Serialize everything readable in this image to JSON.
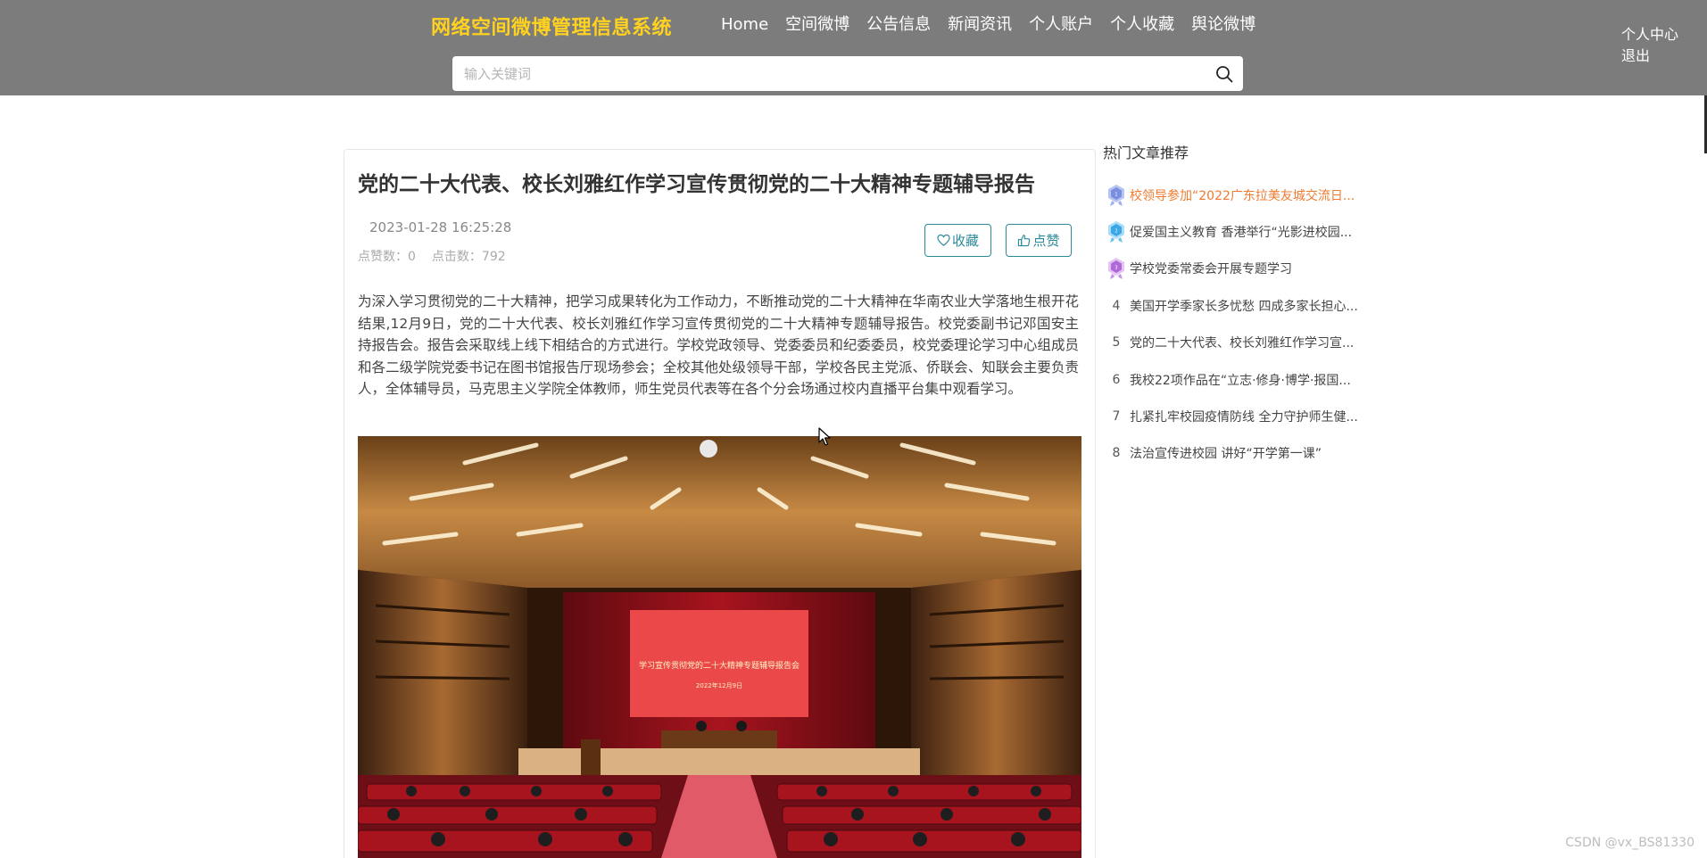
{
  "header": {
    "brand": "网络空间微博管理信息系统",
    "nav": [
      "Home",
      "空间微博",
      "公告信息",
      "新闻资讯",
      "个人账户",
      "个人收藏",
      "舆论微博"
    ],
    "user_links": {
      "center": "个人中心",
      "logout": "退出"
    },
    "search": {
      "placeholder": "输入关键词",
      "value": ""
    },
    "colors": {
      "bar": "#7c7c7c",
      "brand": "#ffd21f"
    }
  },
  "article": {
    "title": "党的二十大代表、校长刘雅红作学习宣传贯彻党的二十大精神专题辅导报告",
    "date": "2023-01-28 16:25:28",
    "likes_label": "点赞数：0",
    "clicks_label": "点击数：792",
    "favorite_label": "收藏",
    "like_label": "点赞",
    "accent_color": "#2b8a9a",
    "body": "为深入学习贯彻党的二十大精神，把学习成果转化为工作动力，不断推动党的二十大精神在华南农业大学落地生根开花结果,12月9日，党的二十大代表、校长刘雅红作学习宣传贯彻党的二十大精神专题辅导报告。校党委副书记邓国安主持报告会。报告会采取线上线下相结合的方式进行。学校党政领导、党委委员和纪委委员，校党委理论学习中心组成员和各二级学院党委书记在图书馆报告厅现场参会；全校其他处级领导干部，学校各民主党派、侨联会、知联会主要负责人，全体辅导员，马克思主义学院全体教师，师生党员代表等在各个分会场通过校内直播平台集中观看学习。",
    "image": {
      "banner_title": "学习宣传贯彻党的二十大精神专题辅导报告会",
      "banner_date": "2022年12月9日"
    }
  },
  "sidebar": {
    "title": "热门文章推荐",
    "items": [
      {
        "rank": "1",
        "medal": "gold-medal-icon",
        "text": "校领导参加“2022广东拉美友城交流日..."
      },
      {
        "rank": "2",
        "medal": "silver-medal-icon",
        "text": "促爱国主义教育 香港举行“光影进校园..."
      },
      {
        "rank": "3",
        "medal": "bronze-medal-icon",
        "text": "学校党委常委会开展专题学习"
      },
      {
        "rank": "4",
        "text": "美国开学季家长多忧愁 四成多家长担心..."
      },
      {
        "rank": "5",
        "text": "党的二十大代表、校长刘雅红作学习宣..."
      },
      {
        "rank": "6",
        "text": "我校22项作品在“立志·修身·博学·报国..."
      },
      {
        "rank": "7",
        "text": "扎紧扎牢校园疫情防线 全力守护师生健..."
      },
      {
        "rank": "8",
        "text": "法治宣传进校园 讲好“开学第一课”"
      }
    ],
    "active_color": "#f07b30"
  },
  "watermark": "CSDN @vx_BS81330"
}
